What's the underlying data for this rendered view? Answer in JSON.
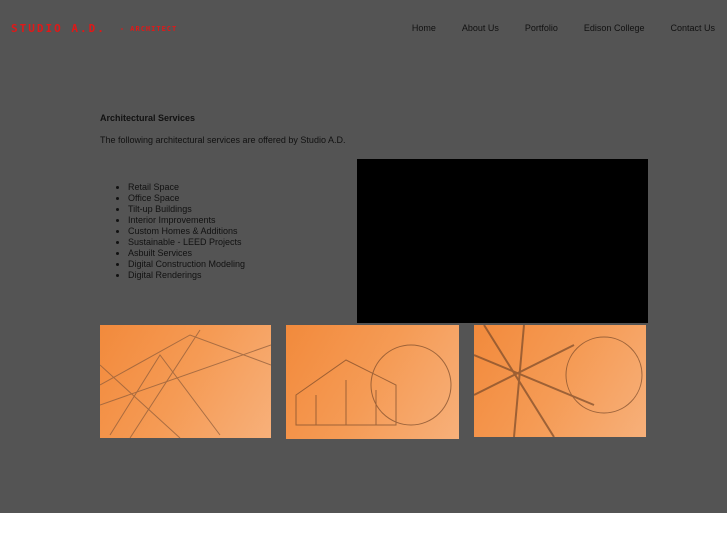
{
  "logo": {
    "main": "STUDIO A.D.",
    "sub": "- ARCHITECT"
  },
  "nav": [
    "Home",
    "About Us",
    "Portfolio",
    "Edison College",
    "Contact Us"
  ],
  "content": {
    "heading": "Architectural Services",
    "intro": "The following architectural services are offered by Studio A.D.",
    "services": [
      "Retail Space",
      "Office Space",
      "Tilt-up Buildings",
      "Interior Improvements",
      "Custom Homes & Additions",
      "Sustainable - LEED Projects",
      "Asbuilt Services",
      "Digital Construction Modeling",
      "Digital Renderings"
    ]
  },
  "colors": {
    "background": "#545454",
    "logo": "#e01818",
    "thumb": "#f28a3c"
  }
}
